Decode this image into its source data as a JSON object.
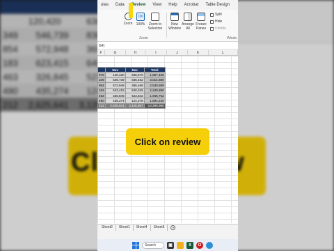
{
  "background": {
    "rows": [
      {
        "a": "",
        "b": "120,420",
        "c": "636"
      },
      {
        "a": "349",
        "b": "546,739",
        "c": "836"
      },
      {
        "a": "854",
        "b": "572,948",
        "c": "365"
      },
      {
        "a": "183",
        "b": "623,415",
        "c": "640"
      },
      {
        "a": "463",
        "b": "326,845",
        "c": "523"
      },
      {
        "a": "490",
        "b": "435,274",
        "c": "124"
      },
      {
        "a": "212",
        "b": "2,625,641",
        "c": "3,126"
      }
    ],
    "callout_left": "Cli",
    "callout_right": "ew"
  },
  "ribbon": {
    "tabs": [
      "ulas",
      "Data",
      "Review",
      "View",
      "Help",
      "Acrobat",
      "Table Design"
    ],
    "active_tab": "Review",
    "zoom_label": "Zoom",
    "zoom100_label": "100%",
    "zoom100_icon_text": "100",
    "zoom_selection_label": "Zoom to Selection",
    "group_zoom": "Zoom",
    "new_window_label": "New Window",
    "arrange_all_label": "Arrange All",
    "freeze_panes_label": "Freeze Panes",
    "split_label": "Split",
    "hide_label": "Hide",
    "unhide_label": "Unhide",
    "group_window": "Windo"
  },
  "formula_bar": {
    "cell_ref": "G4)"
  },
  "columns": [
    "F",
    "G",
    "H",
    "I",
    "J",
    "K",
    "L"
  ],
  "table": {
    "headers": [
      "",
      "Nov",
      "Dec",
      "Total"
    ],
    "rows": [
      [
        "675",
        "120,420",
        "636,570",
        "1,867,459"
      ],
      [
        "349",
        "546,739",
        "836,452",
        "3,014,880"
      ],
      [
        "854",
        "572,948",
        "365,468",
        "2,530,989"
      ],
      [
        "183",
        "623,415",
        "640,345",
        "2,240,890"
      ],
      [
        "463",
        "326,845",
        "523,842",
        "1,946,752"
      ],
      [
        "490",
        "435,274",
        "124,378",
        "1,804,220"
      ]
    ],
    "total_row": [
      "212",
      "2,625,641",
      "3,126,867",
      "13,398,960"
    ]
  },
  "callout": {
    "text": "Click on review",
    "color": "#f5cf0a"
  },
  "sheet_tabs": [
    "Sheet2",
    "Sheet1",
    "Sheet4",
    "Sheet5"
  ],
  "taskbar": {
    "search_label": "Search"
  },
  "colors": {
    "header_navy": "#1f3864",
    "total_gray": "#7f7f7f",
    "excel_green": "#185c37"
  }
}
